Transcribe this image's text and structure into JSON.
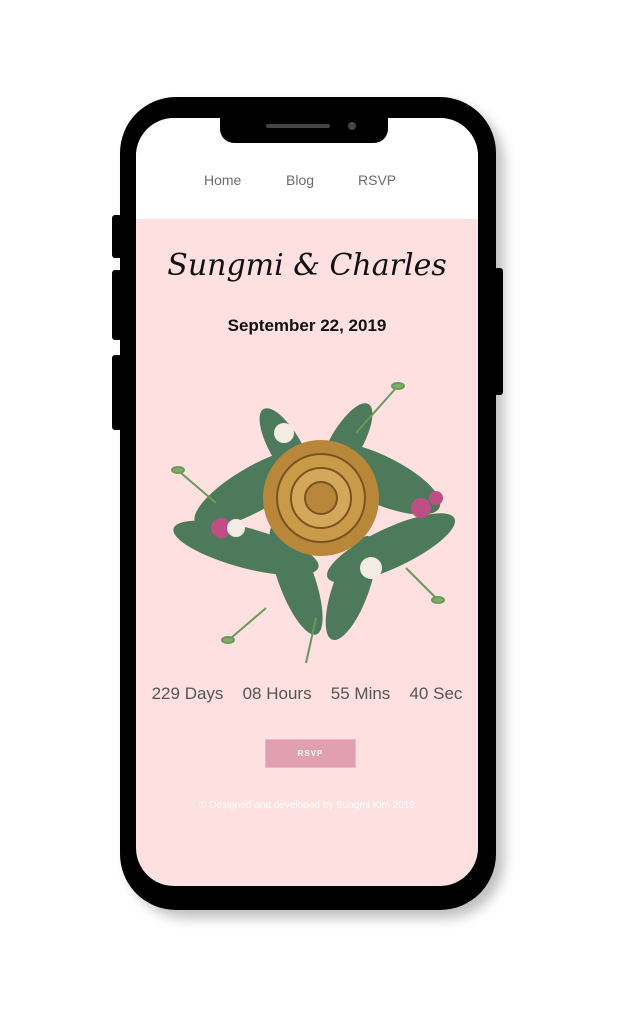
{
  "nav": {
    "items": [
      {
        "label": "Home"
      },
      {
        "label": "Blog"
      },
      {
        "label": "RSVP"
      }
    ]
  },
  "hero": {
    "names": "Sungmi & Charles",
    "date": "September 22, 2019"
  },
  "countdown": [
    {
      "value": "229",
      "unit": "Days"
    },
    {
      "value": "08",
      "unit": "Hours"
    },
    {
      "value": "55",
      "unit": "Mins"
    },
    {
      "value": "40",
      "unit": "Sec"
    }
  ],
  "rsvp_button": "RSVP",
  "footer": "© Designed and developed by Sungmi Kim 2018",
  "colors": {
    "background": "#fde0df",
    "button": "#e0a0b0",
    "phone": "#000000"
  }
}
